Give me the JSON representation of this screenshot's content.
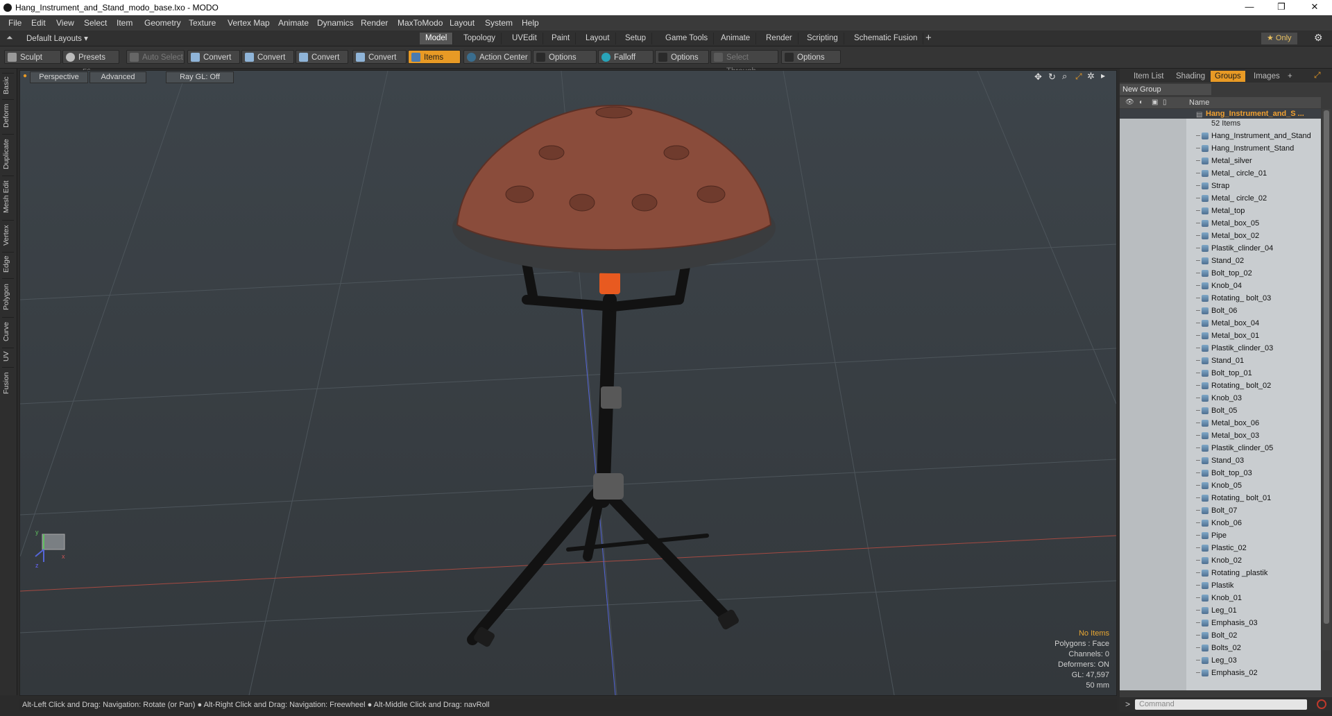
{
  "window": {
    "title": "Hang_Instrument_and_Stand_modo_base.lxo - MODO",
    "minimize": "—",
    "maximize": "❐",
    "close": "✕"
  },
  "menu": [
    "File",
    "Edit",
    "View",
    "Select",
    "Item",
    "Geometry",
    "Texture",
    "Vertex Map",
    "Animate",
    "Dynamics",
    "Render",
    "MaxToModo",
    "Layout",
    "System",
    "Help"
  ],
  "layoutbar": {
    "default_layouts": "Default Layouts ▾",
    "tabs": [
      "Model",
      "Topology",
      "UVEdit",
      "Paint",
      "Layout",
      "Setup",
      "Game Tools",
      "Animate",
      "Render",
      "Scripting",
      "Schematic Fusion"
    ],
    "active_tab": "Model",
    "add": "+",
    "only": "★  Only",
    "gear": "⚙"
  },
  "toolbar": {
    "sculpt": "Sculpt",
    "presets": "Presets",
    "presets_key": "F6",
    "auto_select": "Auto Select",
    "convert1": "Convert",
    "convert2": "Convert",
    "convert3": "Convert",
    "convert4": "Convert",
    "items": "Items",
    "action_center": "Action Center",
    "options1": "Options",
    "falloff": "Falloff",
    "options2": "Options",
    "select_through": "Select Through",
    "options3": "Options"
  },
  "left_tabs": [
    "Basic",
    "Deform",
    "Duplicate",
    "Mesh Edit",
    "Vertex",
    "Edge",
    "Polygon",
    "Curve",
    "UV",
    "Fusion"
  ],
  "viewport": {
    "perspective": "Perspective",
    "advanced": "Advanced",
    "raygl": "Ray GL: Off",
    "info": {
      "no_items": "No Items",
      "polygons": "Polygons : Face",
      "channels": "Channels: 0",
      "deformers": "Deformers: ON",
      "gl": "GL: 47,597",
      "focal": "50 mm"
    },
    "axis_y": "y",
    "axis_x": "x",
    "axis_z": "z"
  },
  "statusbar": "Alt-Left Click and Drag: Navigation: Rotate (or Pan) ● Alt-Right Click and Drag: Navigation: Freewheel ● Alt-Middle Click and Drag: navRoll",
  "right_panel": {
    "tabs": [
      "Item List",
      "Shading",
      "Groups",
      "Images",
      "+"
    ],
    "active_tab": "Groups",
    "new_group": "New Group",
    "name_header": "Name",
    "group_name": "Hang_Instrument_and_S ...",
    "group_count": "52 Items",
    "items": [
      "Hang_Instrument_and_Stand",
      "Hang_Instrument_Stand",
      "Metal_silver",
      "Metal_ circle_01",
      "Strap",
      "Metal_ circle_02",
      "Metal_top",
      "Metal_box_05",
      "Metal_box_02",
      "Plastik_clinder_04",
      "Stand_02",
      "Bolt_top_02",
      "Knob_04",
      "Rotating_ bolt_03",
      "Bolt_06",
      "Metal_box_04",
      "Metal_box_01",
      "Plastik_clinder_03",
      "Stand_01",
      "Bolt_top_01",
      "Rotating_ bolt_02",
      "Knob_03",
      "Bolt_05",
      "Metal_box_06",
      "Metal_box_03",
      "Plastik_clinder_05",
      "Stand_03",
      "Bolt_top_03",
      "Knob_05",
      "Rotating_ bolt_01",
      "Bolt_07",
      "Knob_06",
      "Pipe",
      "Plastic_02",
      "Knob_02",
      "Rotating _plastik",
      "Plastik",
      "Knob_01",
      "Leg_01",
      "Emphasis_03",
      "Bolt_02",
      "Bolts_02",
      "Leg_03",
      "Emphasis_02"
    ],
    "command_placeholder": "Command",
    "prompt": ">"
  }
}
